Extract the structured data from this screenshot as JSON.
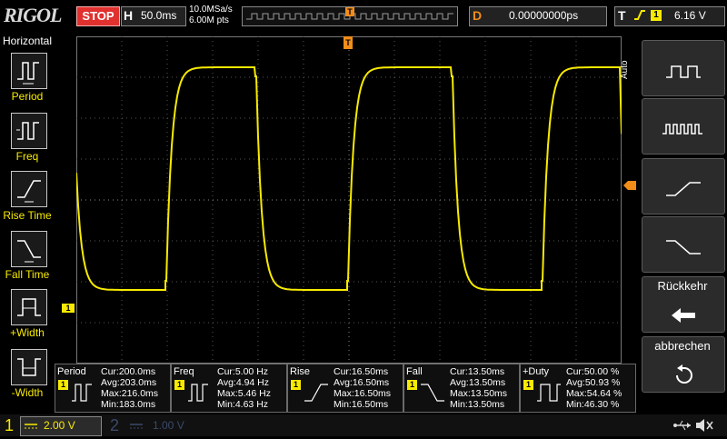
{
  "header": {
    "logo": "RIGOL",
    "run_state": "STOP",
    "timebase_letter": "H",
    "timebase": "50.0ms",
    "sample_rate": "10.0MSa/s",
    "memory_depth": "6.00M pts",
    "trigger_marker": "T",
    "delay_letter": "D",
    "delay": "0.00000000ps",
    "trigger_letter": "T",
    "trigger_channel": "1",
    "trigger_level": "6.16 V"
  },
  "left_menu": {
    "title": "Horizontal",
    "items": [
      {
        "label": "Period"
      },
      {
        "label": "Freq"
      },
      {
        "label": "Rise Time"
      },
      {
        "label": "Fall Time"
      },
      {
        "label": "+Width"
      },
      {
        "label": "-Width"
      }
    ]
  },
  "right_menu": {
    "mode": "Auto",
    "back_label": "Rückkehr",
    "cancel_label": "abbrechen"
  },
  "markers": {
    "ch1_ground": "1",
    "trigger_top": "T"
  },
  "measurements": [
    {
      "name": "Period",
      "channel": "1",
      "cur": "Cur:200.0ms",
      "avg": "Avg:203.0ms",
      "max": "Max:216.0ms",
      "min": "Min:183.0ms"
    },
    {
      "name": "Freq",
      "channel": "1",
      "cur": "Cur:5.00 Hz",
      "avg": "Avg:4.94 Hz",
      "max": "Max:5.46 Hz",
      "min": "Min:4.63 Hz"
    },
    {
      "name": "Rise",
      "channel": "1",
      "cur": "Cur:16.50ms",
      "avg": "Avg:16.50ms",
      "max": "Max:16.50ms",
      "min": "Min:16.50ms"
    },
    {
      "name": "Fall",
      "channel": "1",
      "cur": "Cur:13.50ms",
      "avg": "Avg:13.50ms",
      "max": "Max:13.50ms",
      "min": "Min:13.50ms"
    },
    {
      "name": "+Duty",
      "channel": "1",
      "cur": "Cur:50.00 %",
      "avg": "Avg:50.93 %",
      "max": "Max:54.64 %",
      "min": "Min:46.30 %"
    }
  ],
  "channels": {
    "ch1_number": "1",
    "ch1_scale": "2.00 V",
    "ch2_number": "2",
    "ch2_scale": "1.00 V"
  },
  "colors": {
    "ch1": "#f7ea00",
    "trigger": "#f28d1a",
    "stop": "#e0312f",
    "grid": "#6a6a6a"
  },
  "icons": {
    "usb": "usb-icon",
    "speaker": "speaker-muted-icon"
  }
}
